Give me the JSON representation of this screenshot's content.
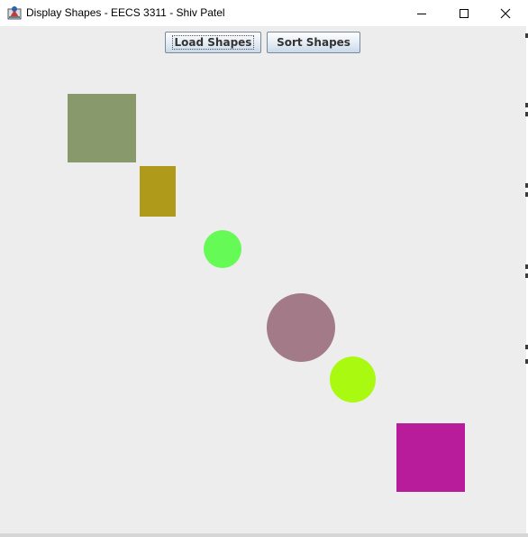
{
  "window": {
    "title": "Display Shapes - EECS 3311 - Shiv Patel",
    "icon": "java-app-icon",
    "controls": [
      "minimize-icon",
      "maximize-icon",
      "close-icon"
    ]
  },
  "toolbar": {
    "load_label": "Load Shapes",
    "sort_label": "Sort Shapes"
  },
  "colors": {
    "content_background": "#eeedee",
    "button_border": "#7a8a99"
  },
  "shapes": [
    {
      "type": "square",
      "color": "#88996b"
    },
    {
      "type": "rectangle",
      "color": "#b09a1a"
    },
    {
      "type": "circle",
      "color": "#66fa57"
    },
    {
      "type": "circle",
      "color": "#a37a87"
    },
    {
      "type": "circle",
      "color": "#a9fa10"
    },
    {
      "type": "square",
      "color": "#b81c9b"
    }
  ]
}
